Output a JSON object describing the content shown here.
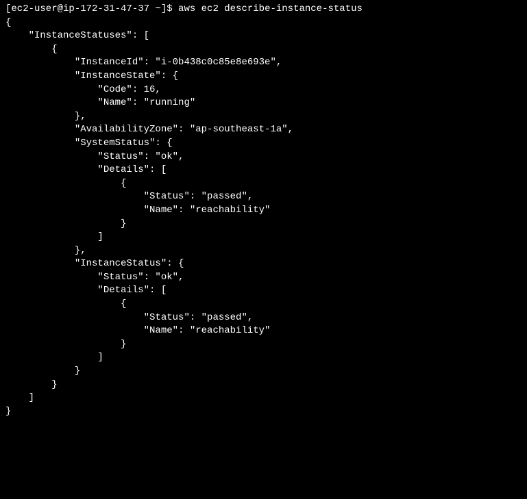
{
  "prompt": {
    "prefix": "[ec2-user@ip-172-31-47-37 ~]$",
    "command": "aws ec2 describe-instance-status"
  },
  "output": {
    "text": "{\n    \"InstanceStatuses\": [\n        {\n            \"InstanceId\": \"i-0b438c0c85e8e693e\",\n            \"InstanceState\": {\n                \"Code\": 16,\n                \"Name\": \"running\"\n            },\n            \"AvailabilityZone\": \"ap-southeast-1a\",\n            \"SystemStatus\": {\n                \"Status\": \"ok\",\n                \"Details\": [\n                    {\n                        \"Status\": \"passed\",\n                        \"Name\": \"reachability\"\n                    }\n                ]\n            },\n            \"InstanceStatus\": {\n                \"Status\": \"ok\",\n                \"Details\": [\n                    {\n                        \"Status\": \"passed\",\n                        \"Name\": \"reachability\"\n                    }\n                ]\n            }\n        }\n    ]\n}"
  },
  "parsed_data": {
    "InstanceStatuses": [
      {
        "InstanceId": "i-0b438c0c85e8e693e",
        "InstanceState": {
          "Code": 16,
          "Name": "running"
        },
        "AvailabilityZone": "ap-southeast-1a",
        "SystemStatus": {
          "Status": "ok",
          "Details": [
            {
              "Status": "passed",
              "Name": "reachability"
            }
          ]
        },
        "InstanceStatus": {
          "Status": "ok",
          "Details": [
            {
              "Status": "passed",
              "Name": "reachability"
            }
          ]
        }
      }
    ]
  }
}
